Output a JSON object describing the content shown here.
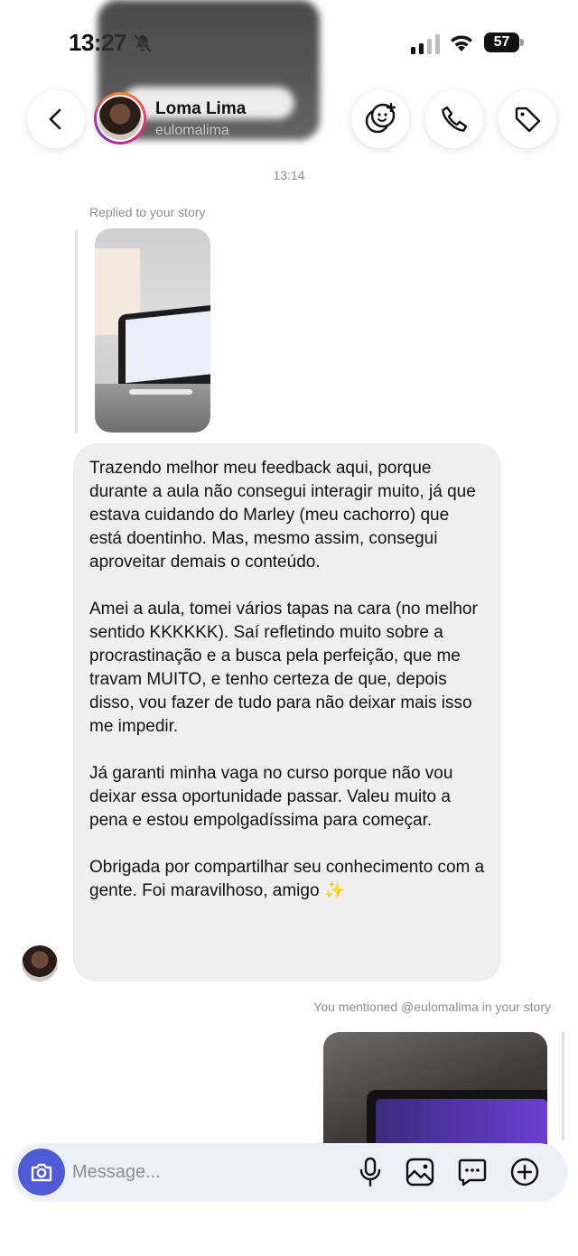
{
  "status_bar": {
    "time": "13:27",
    "battery": "57"
  },
  "header": {
    "contact_name": "Loma Lima",
    "contact_username": "eulomalima"
  },
  "chat": {
    "timestamp": "13:14",
    "reply_label": "Replied to your story",
    "message_paragraphs": [
      "Trazendo melhor meu feedback aqui, porque durante a aula não consegui interagir muito, já que estava cuidando do Marley (meu cachorro) que está doentinho. Mas, mesmo assim, consegui aproveitar demais o conteúdo.",
      "Amei a aula, tomei vários tapas na cara (no melhor sentido KKKKKK). Saí refletindo muito sobre a procrastinação e a busca pela perfeição, que me travam MUITO, e tenho certeza de que, depois disso, vou fazer de tudo para não deixar mais isso me impedir.",
      "Já garanti minha vaga no curso porque não vou deixar essa oportunidade passar. Valeu muito a pena e estou empolgadíssima para começar.",
      "Obrigada por compartilhar seu conhecimento com a gente. Foi maravilhoso, amigo ✨"
    ],
    "mention_label": "You mentioned @eulomalima in your story"
  },
  "composer": {
    "placeholder": "Message..."
  },
  "icons": {
    "back": "chevron-left-icon",
    "effects": "face-plus-icon",
    "call": "phone-icon",
    "tag": "tag-icon",
    "camera": "camera-icon",
    "mic": "microphone-icon",
    "gallery": "image-icon",
    "sticker": "chat-bubble-icon",
    "plus": "plus-circle-icon"
  },
  "colors": {
    "accent": "#4f5bd5",
    "bubble_bg": "#efefef",
    "muted_text": "#8e8e8e"
  }
}
